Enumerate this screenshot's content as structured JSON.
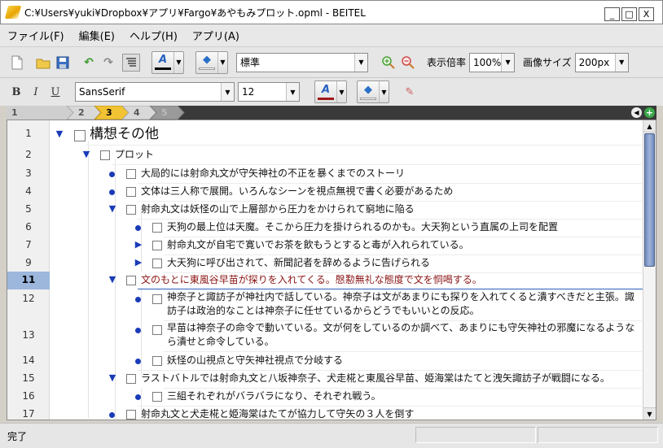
{
  "window": {
    "title": "C:¥Users¥yuki¥Dropbox¥アプリ¥Fargo¥あやもみプロット.opml - BEITEL",
    "minimize": "_",
    "maximize": "□",
    "close": "X"
  },
  "menu": [
    "ファイル(F)",
    "編集(E)",
    "ヘルプ(H)",
    "アプリ(A)"
  ],
  "toolbar": {
    "style_value": "標準",
    "zoom_label": "表示倍率",
    "zoom_value": "100%",
    "image_size_label": "画像サイズ",
    "image_size_value": "200px",
    "font_color": "#000000",
    "highlight_color": "#ffffff"
  },
  "format_toolbar": {
    "bold": "B",
    "italic": "I",
    "underline": "U",
    "font_family": "SansSerif",
    "font_size": "12",
    "font_color": "#a01818",
    "highlight_color": "#ffffff"
  },
  "levels": [
    "1",
    "2",
    "3",
    "4",
    "5"
  ],
  "current_level": "3",
  "outline": [
    {
      "line": "1",
      "type": "triangle-down",
      "text": "構想その他"
    },
    {
      "line": "2",
      "type": "triangle-down",
      "text": "プロット"
    },
    {
      "line": "3",
      "type": "bullet",
      "text": "大局的には射命丸文が守矢神社の不正を暴くまでのストーリ"
    },
    {
      "line": "4",
      "type": "bullet",
      "text": "文体は三人称で展開。いろんなシーンを視点無視で書く必要があるため"
    },
    {
      "line": "5",
      "type": "triangle-down",
      "text": "射命丸文は妖怪の山で上層部から圧力をかけられて窮地に陥る"
    },
    {
      "line": "6",
      "type": "bullet",
      "text": "天狗の最上位は天魔。そこから圧力を掛けられるのかも。大天狗という直属の上司を配置"
    },
    {
      "line": "7",
      "type": "triangle-right",
      "text": "射命丸文が自宅で寛いでお茶を飲もうとすると毒が入れられている。"
    },
    {
      "line": "9",
      "type": "triangle-right",
      "text": "大天狗に呼び出されて、新聞記者を辞めるように告げられる"
    },
    {
      "line": "11",
      "type": "triangle-down",
      "text": "文のもとに東風谷早苗が探りを入れてくる。慇懃無礼な態度で文を恫喝する。"
    },
    {
      "line": "12",
      "type": "bullet",
      "text": "神奈子と諏訪子が神社内で話している。神奈子は文があまりにも探りを入れてくると潰すべきだと主張。諏訪子は政治的なことは神奈子に任せているからどうでもいいとの反応。"
    },
    {
      "line": "13",
      "type": "bullet",
      "text": "早苗は神奈子の命令で動いている。文が何をしているのか調べて、あまりにも守矢神社の邪魔になるようなら潰せと命令している。"
    },
    {
      "line": "14",
      "type": "bullet",
      "text": "妖怪の山視点と守矢神社視点で分岐する"
    },
    {
      "line": "15",
      "type": "triangle-down",
      "text": "ラストバトルでは射命丸文と八坂神奈子、犬走椛と東風谷早苗、姫海棠はたてと洩矢諏訪子が戦闘になる。"
    },
    {
      "line": "16",
      "type": "bullet",
      "text": "三組それぞれがバラバラになり、それぞれ戦う。"
    },
    {
      "line": "17",
      "type": "bullet",
      "text": "射命丸文と犬走椛と姫海棠はたてが協力して守矢の３人を倒す"
    }
  ],
  "status": {
    "text": "完了"
  }
}
